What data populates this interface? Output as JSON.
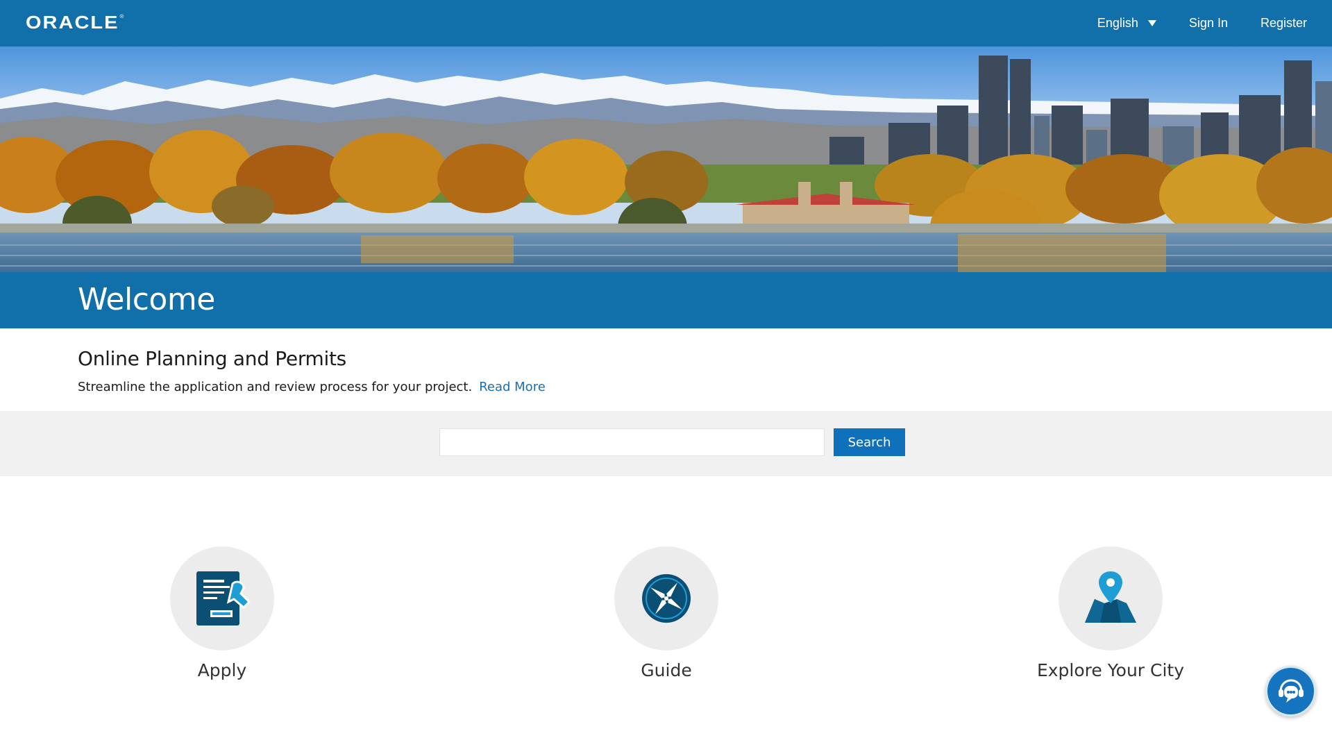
{
  "header": {
    "logo_text": "ORACLE",
    "logo_mark": "®",
    "language": "English",
    "sign_in": "Sign In",
    "register": "Register"
  },
  "welcome": {
    "title": "Welcome"
  },
  "intro": {
    "heading": "Online Planning and Permits",
    "description": "Streamline the application and review process for your project.",
    "read_more": "Read More"
  },
  "search": {
    "value": "",
    "button_label": "Search"
  },
  "tiles": [
    {
      "label": "Apply",
      "icon": "application-form-icon"
    },
    {
      "label": "Guide",
      "icon": "compass-icon"
    },
    {
      "label": "Explore Your City",
      "icon": "map-pin-icon"
    }
  ],
  "chat": {
    "icon": "chat-assistant-icon"
  },
  "colors": {
    "brand_blue": "#1170a9",
    "button_blue": "#0f71bc",
    "link_blue": "#1b6fb0",
    "band_gray": "#f1f1f1",
    "tile_circle": "#ececec",
    "icon_dark": "#0b4f74",
    "icon_light": "#1f9ed6"
  }
}
